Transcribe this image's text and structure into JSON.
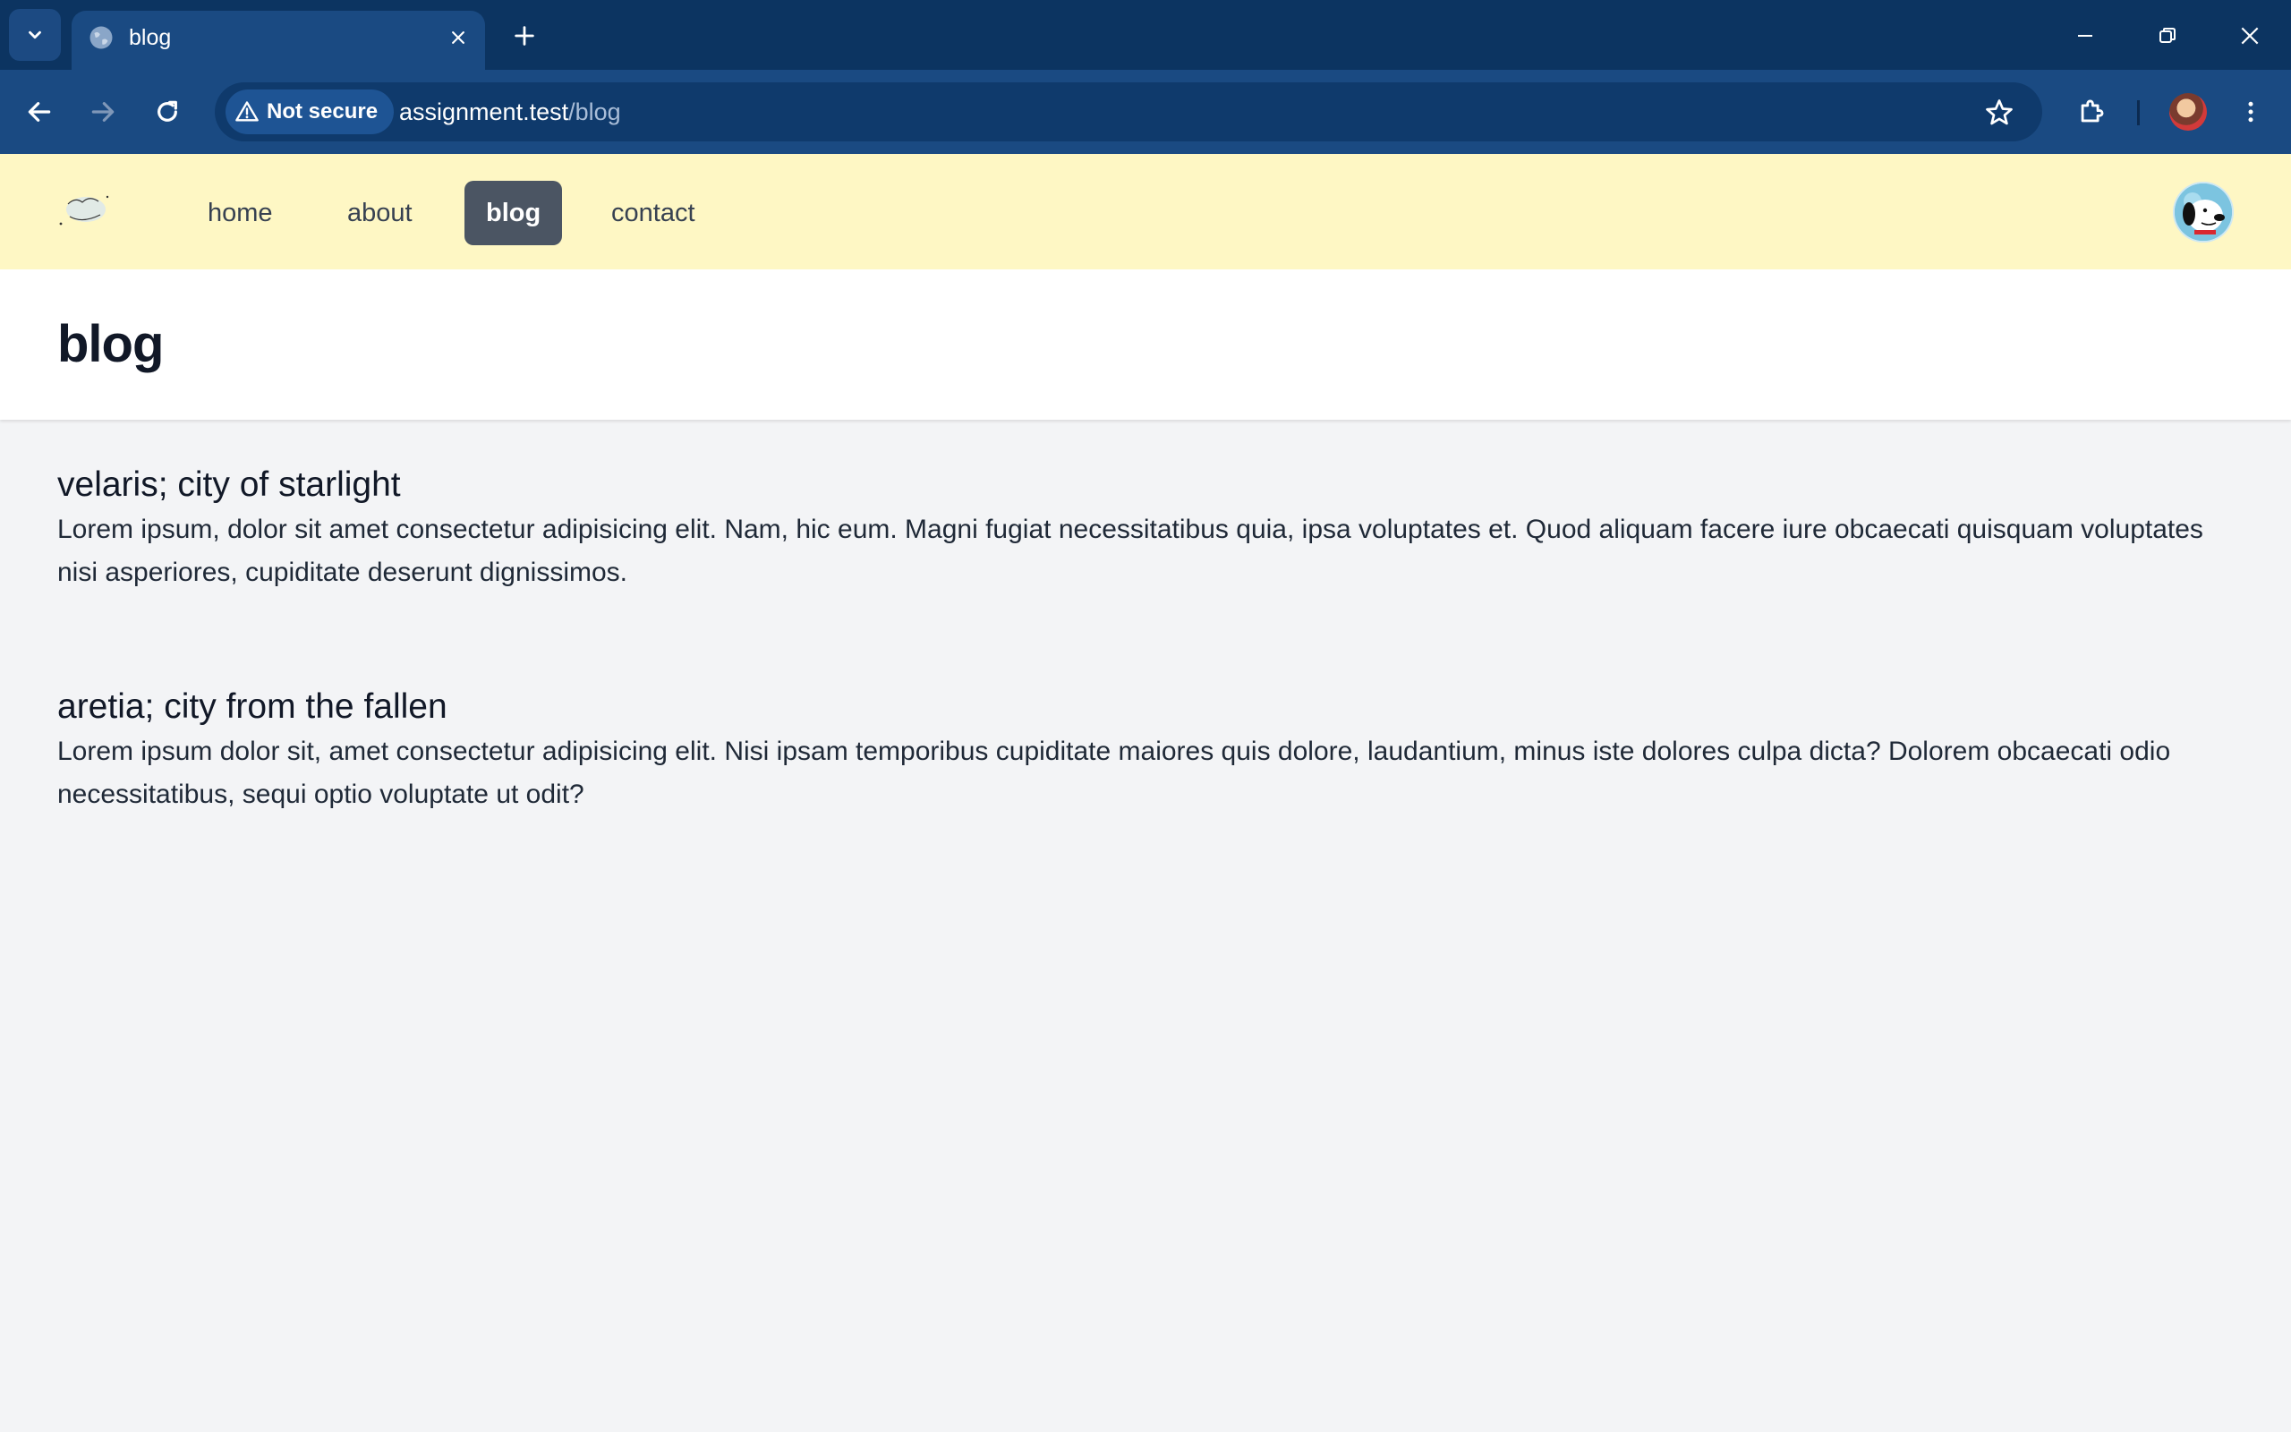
{
  "browser": {
    "tab": {
      "title": "blog"
    },
    "omnibox": {
      "security_label": "Not secure",
      "url_host": "assignment.test",
      "url_path": "/blog"
    },
    "colors": {
      "frame": "#0c3461",
      "toolbar": "#1a4a82"
    }
  },
  "site": {
    "logo_alt": "skye web.",
    "nav": [
      {
        "label": "home",
        "active": false
      },
      {
        "label": "about",
        "active": false
      },
      {
        "label": "blog",
        "active": true
      },
      {
        "label": "contact",
        "active": false
      }
    ],
    "colors": {
      "nav_bg": "#fef7c4",
      "active_link_bg": "#4b5563",
      "content_bg": "#f3f4f6"
    }
  },
  "page": {
    "title": "blog"
  },
  "posts": [
    {
      "title": "velaris; city of starlight",
      "body": "Lorem ipsum, dolor sit amet consectetur adipisicing elit. Nam, hic eum. Magni fugiat necessitatibus quia, ipsa voluptates et. Quod aliquam facere iure obcaecati quisquam voluptates nisi asperiores, cupiditate deserunt dignissimos."
    },
    {
      "title": "aretia; city from the fallen",
      "body": "Lorem ipsum dolor sit, amet consectetur adipisicing elit. Nisi ipsam temporibus cupiditate maiores quis dolore, laudantium, minus iste dolores culpa dicta? Dolorem obcaecati odio necessitatibus, sequi optio voluptate ut odit?"
    }
  ]
}
